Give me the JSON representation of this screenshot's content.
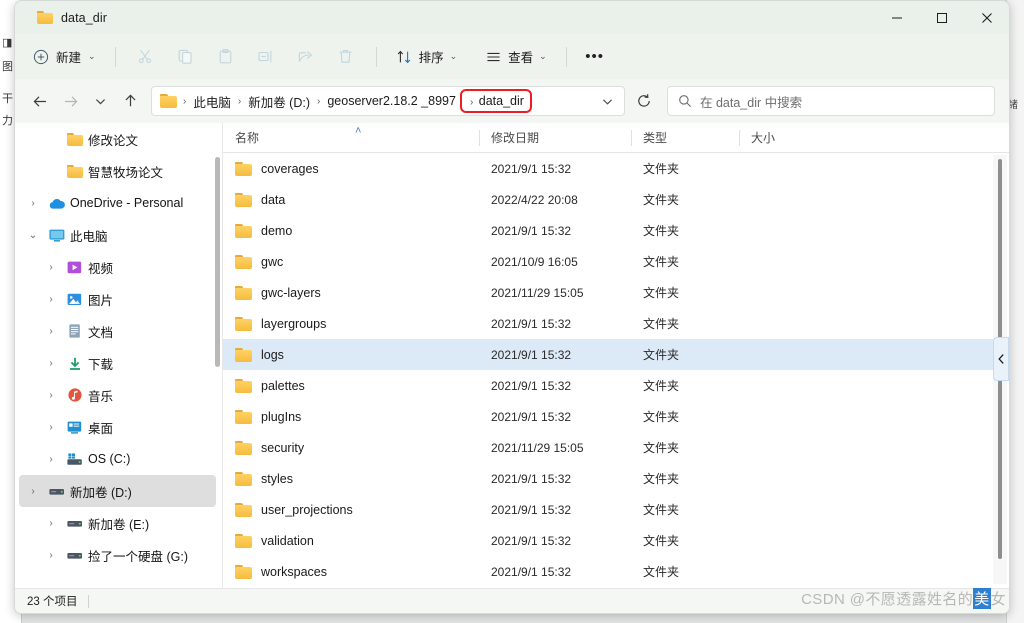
{
  "window": {
    "tab_title": "data_dir",
    "tab_icon": "folder-icon",
    "controls": {
      "minimize": "minimize-icon",
      "maximize": "maximize-icon",
      "close": "close-icon"
    }
  },
  "toolbar": {
    "new_label": "新建",
    "new_icon": "plus-circle-icon",
    "cut_icon": "scissors-icon",
    "copy_icon": "copy-icon",
    "paste_icon": "paste-icon",
    "rename_icon": "rename-icon",
    "share_icon": "share-icon",
    "delete_icon": "trash-icon",
    "sort_label": "排序",
    "sort_icon": "sort-arrows-icon",
    "view_label": "查看",
    "view_icon": "list-lines-icon",
    "more_label": "•••"
  },
  "address": {
    "back_icon": "arrow-left-icon",
    "forward_icon": "arrow-right-icon",
    "recent_icon": "chevron-down-icon",
    "up_icon": "arrow-up-icon",
    "home_icon": "folder-icon",
    "crumbs": [
      {
        "label": "此电脑",
        "highlighted": false
      },
      {
        "label": "新加卷 (D:)",
        "highlighted": false
      },
      {
        "label": "geoserver2.18.2 _8997",
        "highlighted": false
      },
      {
        "label": "data_dir",
        "highlighted": true
      }
    ],
    "dropdown_icon": "chevron-down-icon",
    "refresh_icon": "refresh-icon",
    "highlight_color": "#ee1d22"
  },
  "search": {
    "icon": "search-icon",
    "placeholder": "在 data_dir 中搜索",
    "value": ""
  },
  "sidebar": {
    "items": [
      {
        "label": "修改论文",
        "icon": "folder-icon",
        "indent": 1,
        "twisty": "none",
        "selected": false
      },
      {
        "label": "智慧牧场论文",
        "icon": "folder-icon",
        "indent": 1,
        "twisty": "none",
        "selected": false
      },
      {
        "label": "OneDrive - Personal",
        "icon": "cloud-icon",
        "indent": 0,
        "twisty": "right",
        "selected": false
      },
      {
        "label": "此电脑",
        "icon": "monitor-icon",
        "indent": 0,
        "twisty": "down",
        "selected": false
      },
      {
        "label": "视频",
        "icon": "video-icon",
        "indent": 1,
        "twisty": "right",
        "selected": false
      },
      {
        "label": "图片",
        "icon": "picture-icon",
        "indent": 1,
        "twisty": "right",
        "selected": false
      },
      {
        "label": "文档",
        "icon": "document-icon",
        "indent": 1,
        "twisty": "right",
        "selected": false
      },
      {
        "label": "下载",
        "icon": "download-icon",
        "indent": 1,
        "twisty": "right",
        "selected": false
      },
      {
        "label": "音乐",
        "icon": "music-icon",
        "indent": 1,
        "twisty": "right",
        "selected": false
      },
      {
        "label": "桌面",
        "icon": "desktop-icon",
        "indent": 1,
        "twisty": "right",
        "selected": false
      },
      {
        "label": "OS (C:)",
        "icon": "os-drive-icon",
        "indent": 1,
        "twisty": "right",
        "selected": false
      },
      {
        "label": "新加卷 (D:)",
        "icon": "drive-icon",
        "indent": 1,
        "twisty": "right",
        "selected": true
      },
      {
        "label": "新加卷 (E:)",
        "icon": "drive-icon",
        "indent": 1,
        "twisty": "right",
        "selected": false
      },
      {
        "label": "捡了一个硬盘 (G:)",
        "icon": "drive-icon",
        "indent": 1,
        "twisty": "right",
        "selected": false
      }
    ]
  },
  "filelist": {
    "columns": [
      {
        "label": "名称",
        "key": "name",
        "sorted": "asc"
      },
      {
        "label": "修改日期",
        "key": "date",
        "sorted": ""
      },
      {
        "label": "类型",
        "key": "type",
        "sorted": ""
      },
      {
        "label": "大小",
        "key": "size",
        "sorted": ""
      }
    ],
    "sort_arrow": "˄",
    "rows": [
      {
        "name": "coverages",
        "date": "2021/9/1 15:32",
        "type": "文件夹",
        "size": "",
        "icon": "folder-icon",
        "selected": false
      },
      {
        "name": "data",
        "date": "2022/4/22 20:08",
        "type": "文件夹",
        "size": "",
        "icon": "folder-icon",
        "selected": false
      },
      {
        "name": "demo",
        "date": "2021/9/1 15:32",
        "type": "文件夹",
        "size": "",
        "icon": "folder-icon",
        "selected": false
      },
      {
        "name": "gwc",
        "date": "2021/10/9 16:05",
        "type": "文件夹",
        "size": "",
        "icon": "folder-icon",
        "selected": false
      },
      {
        "name": "gwc-layers",
        "date": "2021/11/29 15:05",
        "type": "文件夹",
        "size": "",
        "icon": "folder-icon",
        "selected": false
      },
      {
        "name": "layergroups",
        "date": "2021/9/1 15:32",
        "type": "文件夹",
        "size": "",
        "icon": "folder-icon",
        "selected": false
      },
      {
        "name": "logs",
        "date": "2021/9/1 15:32",
        "type": "文件夹",
        "size": "",
        "icon": "folder-icon",
        "selected": true
      },
      {
        "name": "palettes",
        "date": "2021/9/1 15:32",
        "type": "文件夹",
        "size": "",
        "icon": "folder-icon",
        "selected": false
      },
      {
        "name": "plugIns",
        "date": "2021/9/1 15:32",
        "type": "文件夹",
        "size": "",
        "icon": "folder-icon",
        "selected": false
      },
      {
        "name": "security",
        "date": "2021/11/29 15:05",
        "type": "文件夹",
        "size": "",
        "icon": "folder-icon",
        "selected": false
      },
      {
        "name": "styles",
        "date": "2021/9/1 15:32",
        "type": "文件夹",
        "size": "",
        "icon": "folder-icon",
        "selected": false
      },
      {
        "name": "user_projections",
        "date": "2021/9/1 15:32",
        "type": "文件夹",
        "size": "",
        "icon": "folder-icon",
        "selected": false
      },
      {
        "name": "validation",
        "date": "2021/9/1 15:32",
        "type": "文件夹",
        "size": "",
        "icon": "folder-icon",
        "selected": false
      },
      {
        "name": "workspaces",
        "date": "2021/9/1 15:32",
        "type": "文件夹",
        "size": "",
        "icon": "folder-icon",
        "selected": false
      }
    ],
    "collapse_icon": "chevron-left-icon"
  },
  "statusbar": {
    "item_count": "23 个项目"
  },
  "watermark": {
    "prefix": "CSDN @不愿透露姓名的",
    "highlighted": "美",
    "suffix": "女"
  }
}
